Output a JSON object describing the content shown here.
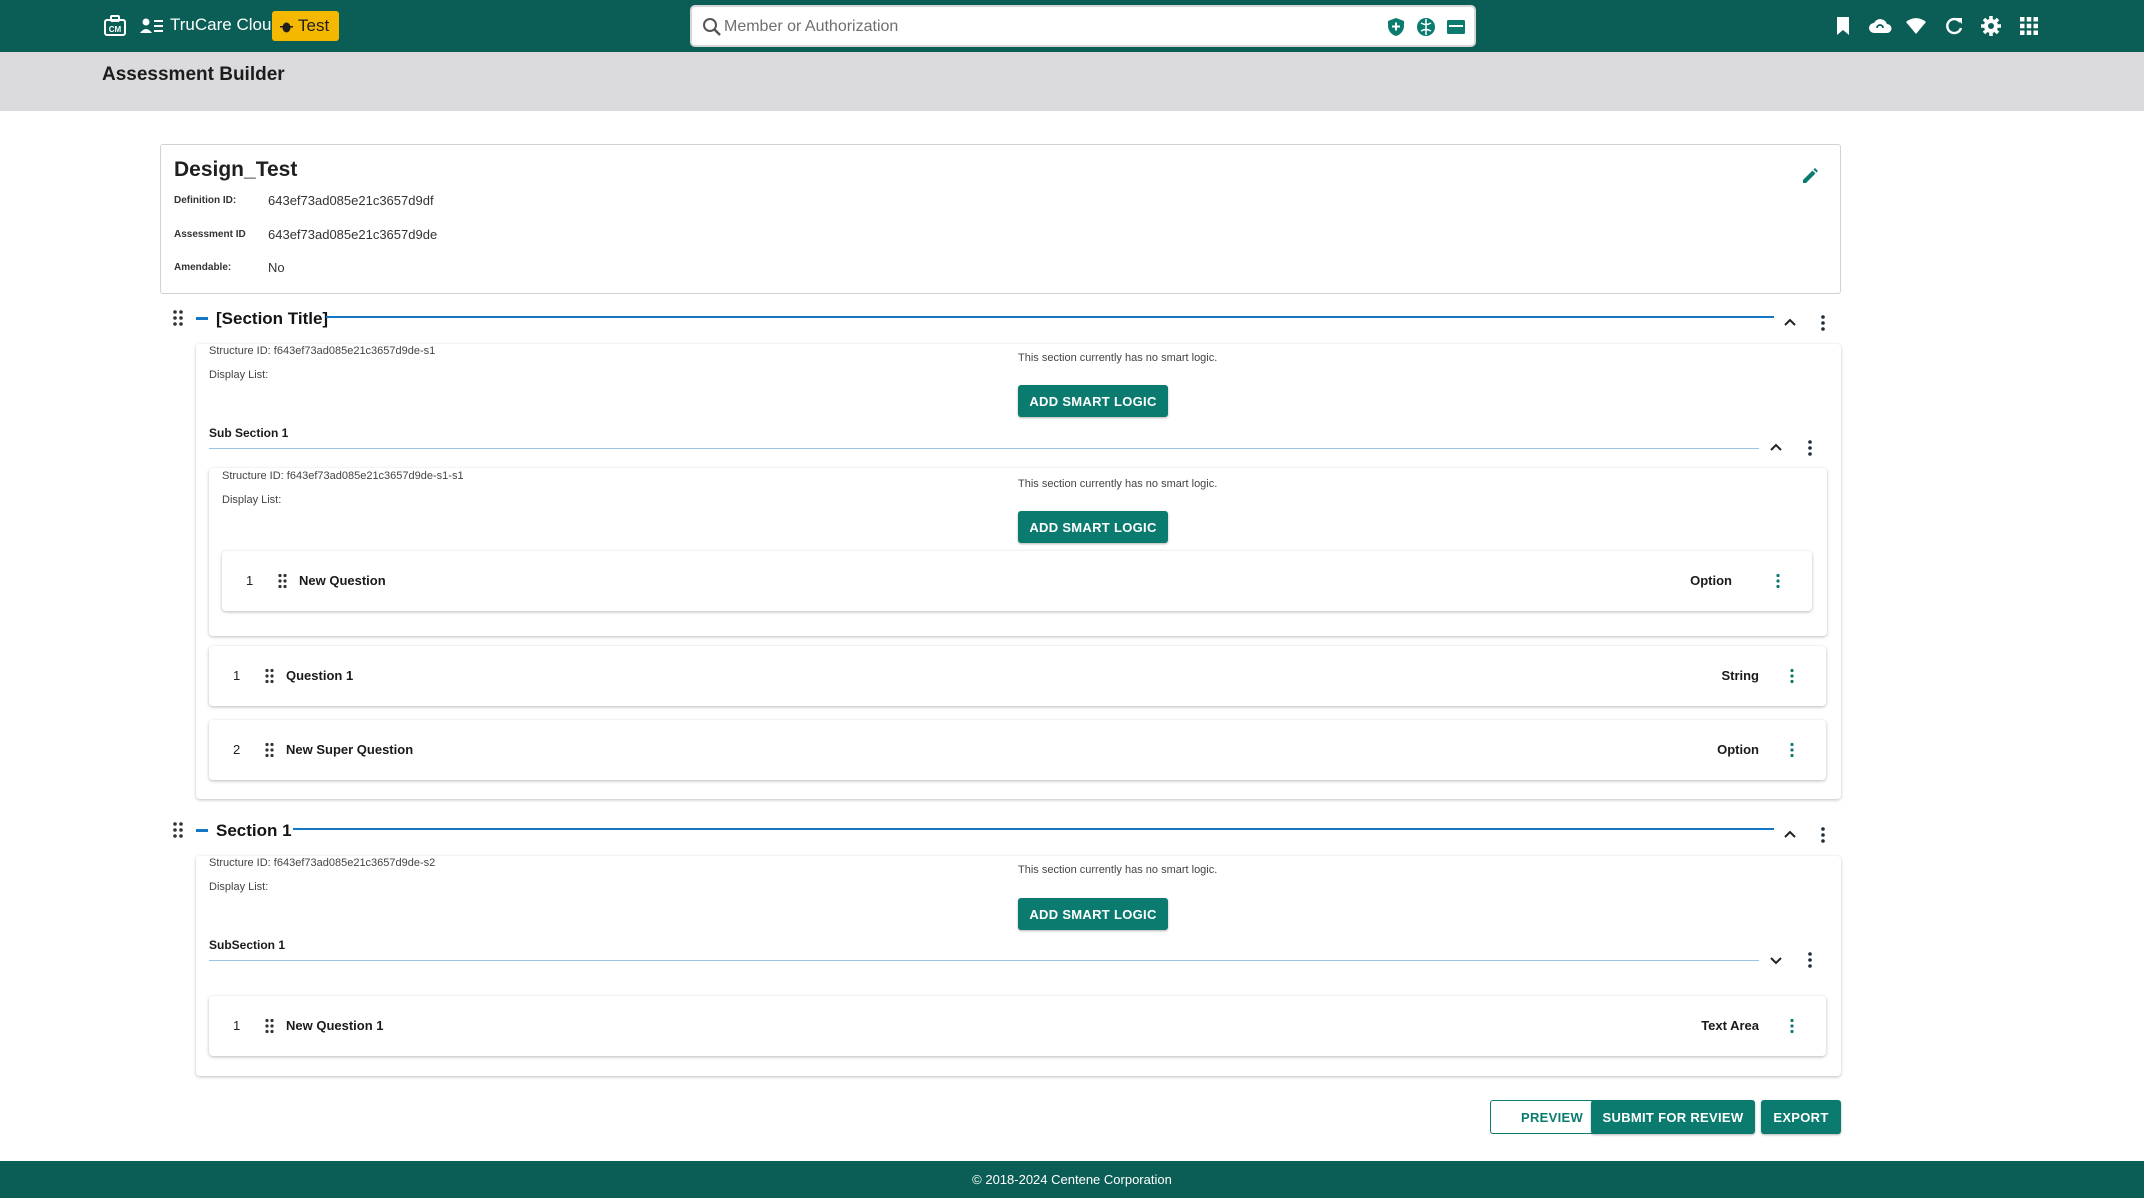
{
  "topbar": {
    "app_name": "TruCare Cloud",
    "env_badge": "Test",
    "search_placeholder": "Member or Authorization",
    "icons": [
      "home-icon",
      "members-icon",
      "search-icon",
      "shield-plus-icon",
      "globe-icon",
      "card-icon",
      "bookmark-icon",
      "cloud-sync-icon",
      "wifi-icon",
      "refresh-icon",
      "settings-icon",
      "apps-grid-icon"
    ],
    "colors": {
      "bar": "#0b5e55",
      "badge": "#f5b800"
    }
  },
  "page": {
    "title": "Assessment Builder"
  },
  "assessment": {
    "name": "Design_Test",
    "fields": [
      {
        "label": "Definition ID:",
        "value": "643ef73ad085e21c3657d9df"
      },
      {
        "label": "Assessment ID",
        "value": "643ef73ad085e21c3657d9de"
      },
      {
        "label": "Amendable:",
        "value": "No"
      }
    ]
  },
  "sections": [
    {
      "title": "[Section Title]",
      "structure_id": "Structure ID: f643ef73ad085e21c3657d9de-s1",
      "display_list": "Display List:",
      "no_logic": "This section currently has no smart logic.",
      "smart_logic_label": "ADD SMART LOGIC",
      "subsection": {
        "title": "Sub Section 1",
        "structure_id": "Structure ID: f643ef73ad085e21c3657d9de-s1-s1",
        "display_list": "Display List:",
        "no_logic": "This section currently has no smart logic.",
        "smart_logic_label": "ADD SMART LOGIC",
        "question": {
          "num": "1",
          "label": "New Question",
          "type": "Option"
        }
      },
      "questions": [
        {
          "num": "1",
          "label": "Question 1",
          "type": "String"
        },
        {
          "num": "2",
          "label": "New Super Question",
          "type": "Option"
        }
      ]
    },
    {
      "title": "Section 1",
      "structure_id": "Structure ID: f643ef73ad085e21c3657d9de-s2",
      "display_list": "Display List:",
      "no_logic": "This section currently has no smart logic.",
      "smart_logic_label": "ADD SMART LOGIC",
      "subsection": {
        "title": "SubSection 1"
      },
      "questions": [
        {
          "num": "1",
          "label": "New Question 1",
          "type": "Text Area"
        }
      ]
    }
  ],
  "actions": {
    "preview": "PREVIEW",
    "submit": "SUBMIT FOR REVIEW",
    "export": "EXPORT"
  },
  "footer": {
    "text": "© 2018-2024 Centene Corporation"
  },
  "accent_color": "#0b7b6f",
  "line_color": "#1577c4"
}
